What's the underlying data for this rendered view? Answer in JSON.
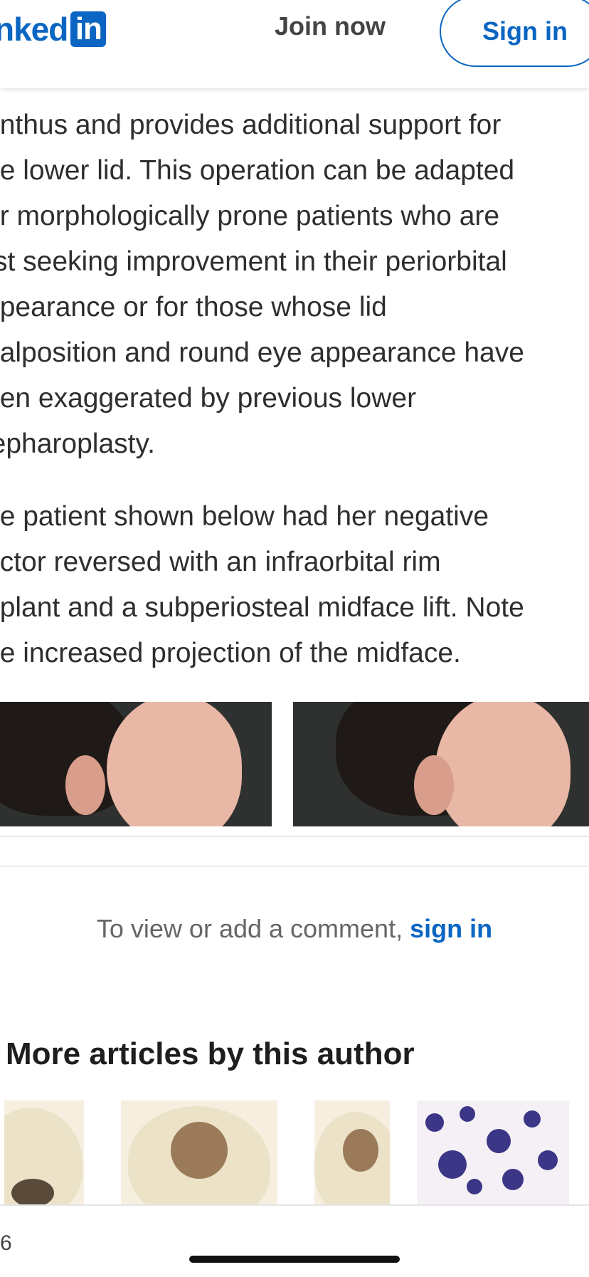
{
  "header": {
    "logo_text": "nked",
    "logo_badge": "in",
    "join_label": "Join now",
    "signin_label": "Sign in"
  },
  "article": {
    "paragraph1": "anthus and provides additional support for\nne lower lid. This operation can be adapted\nor morphologically prone patients who are\nrst seeking improvement in their periorbital\nppearance or for those whose lid\nnalposition and round eye appearance have\neen exaggerated by previous lower\nlepharoplasty.",
    "paragraph2": "he patient shown below had her negative\nector reversed with an infraorbital rim\nnplant and a subperiosteal midface lift. Note\nne increased projection of the midface."
  },
  "comment": {
    "prefix": "To view or add a comment, ",
    "link": "sign in"
  },
  "more_articles": {
    "title": "More articles by this author"
  },
  "footer": {
    "page_fragment": "6"
  },
  "colors": {
    "brand": "#0a66c2",
    "text": "#2e2e2e"
  }
}
